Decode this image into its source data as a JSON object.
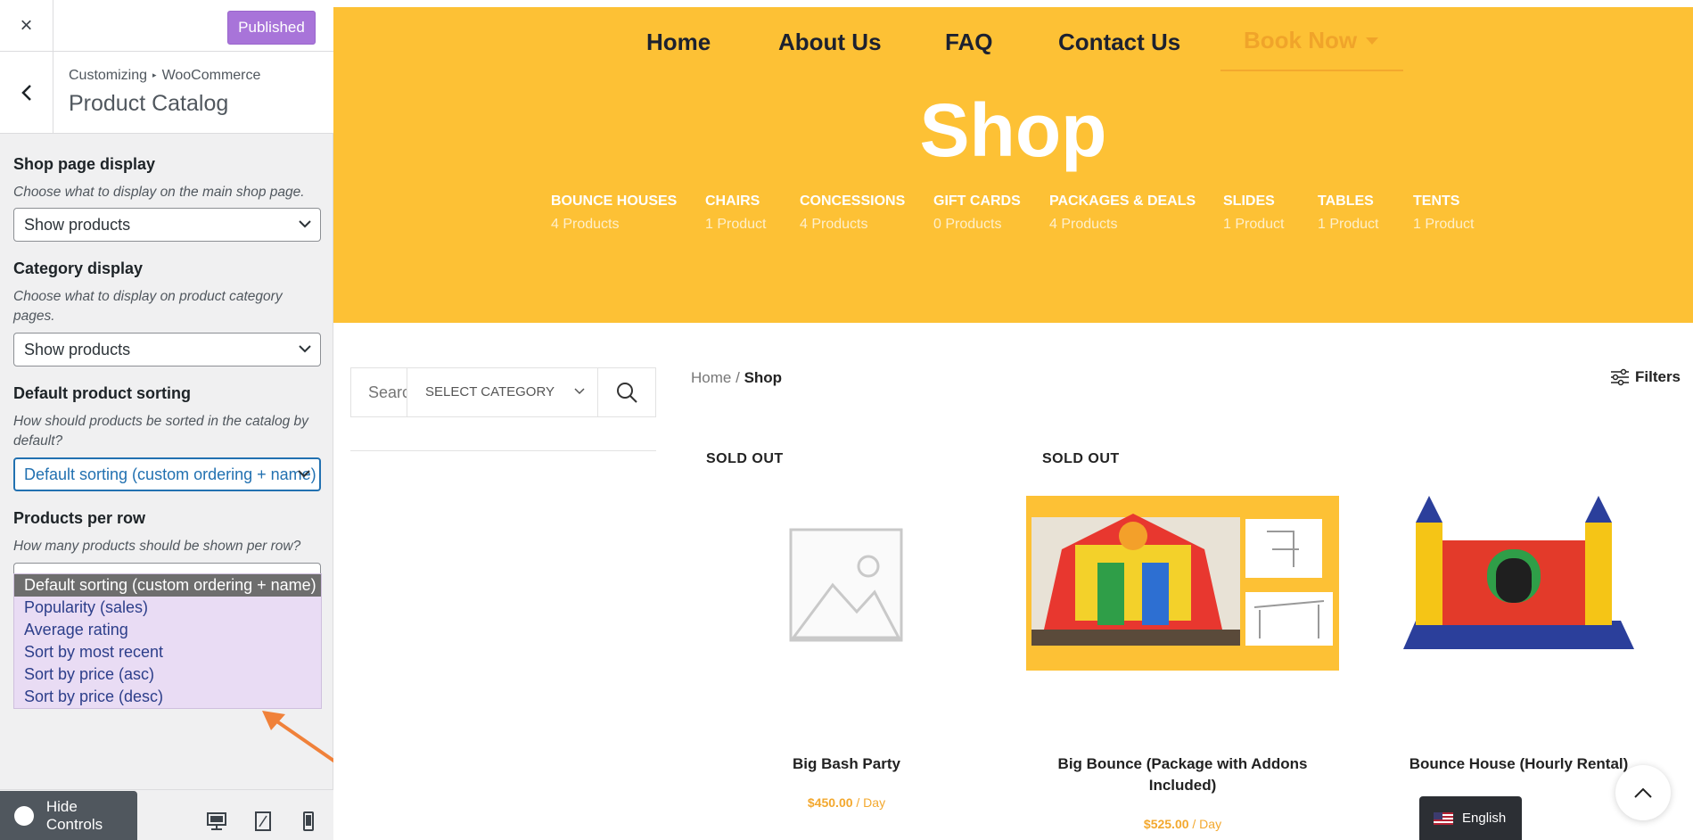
{
  "sidebar": {
    "close_icon": "×",
    "publish_label": "Published",
    "breadcrumb": {
      "root": "Customizing",
      "section": "WooCommerce"
    },
    "panel_title": "Product Catalog",
    "controls": {
      "shop_display": {
        "title": "Shop page display",
        "description": "Choose what to display on the main shop page.",
        "value": "Show products"
      },
      "category_display": {
        "title": "Category display",
        "description": "Choose what to display on product category pages.",
        "value": "Show products"
      },
      "default_sorting": {
        "title": "Default product sorting",
        "description": "How should products be sorted in the catalog by default?",
        "value": "Default sorting (custom ordering + name)",
        "options": [
          "Default sorting (custom ordering + name)",
          "Popularity (sales)",
          "Average rating",
          "Sort by most recent",
          "Sort by price (asc)",
          "Sort by price (desc)"
        ]
      },
      "products_per_row": {
        "title": "Products per row",
        "description": "How many products should be shown per row?"
      }
    },
    "hide_controls_label": "Hide Controls"
  },
  "preview": {
    "nav": {
      "home": "Home",
      "about": "About Us",
      "faq": "FAQ",
      "contact": "Contact Us",
      "book": "Book Now"
    },
    "page_title": "Shop",
    "categories": [
      {
        "name": "BOUNCE HOUSES",
        "count": "4 Products"
      },
      {
        "name": "CHAIRS",
        "count": "1 Product"
      },
      {
        "name": "CONCESSIONS",
        "count": "4 Products"
      },
      {
        "name": "GIFT CARDS",
        "count": "0 Products"
      },
      {
        "name": "PACKAGES & DEALS",
        "count": "4 Products"
      },
      {
        "name": "SLIDES",
        "count": "1 Product"
      },
      {
        "name": "TABLES",
        "count": "1 Product"
      },
      {
        "name": "TENTS",
        "count": "1 Product"
      }
    ],
    "search": {
      "placeholder": "Search for products",
      "category_label": "SELECT CATEGORY"
    },
    "breadcrumb": {
      "home": "Home",
      "separator": "/",
      "current": "Shop"
    },
    "filters_label": "Filters",
    "products": [
      {
        "badge": "SOLD OUT",
        "title": "Big Bash Party",
        "price": "$450.00",
        "unit": " / Day"
      },
      {
        "badge": "SOLD OUT",
        "title": "Big Bounce (Package with Addons Included)",
        "price": "$525.00",
        "unit": " / Day"
      },
      {
        "badge": "",
        "title": "Bounce House (Hourly Rental)",
        "price": "",
        "unit": ""
      }
    ],
    "language": "English"
  },
  "colors": {
    "hero": "#fdc135",
    "publish": "#a874d9",
    "dropdown_bg": "#e9dcf4",
    "price": "#f3a82e",
    "annotation_arrow": "#f0813a"
  }
}
